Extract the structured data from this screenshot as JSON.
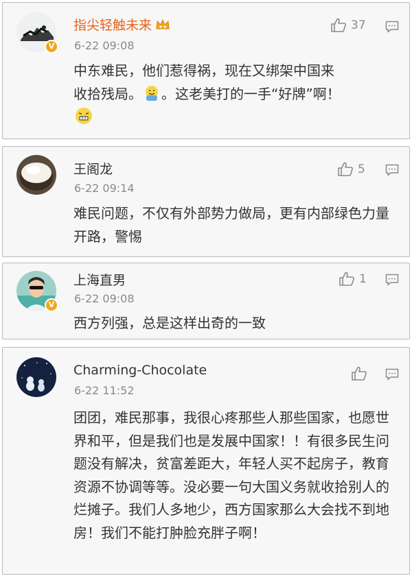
{
  "comments": [
    {
      "username": "指尖轻触未来",
      "time": "6-22 09:08",
      "likes": "37",
      "text_line1": "中东难民，他们惹得祸，现在又绑架中国来",
      "text_line2a": "收拾残局。",
      "text_line2b": "。这老美打的一手“好牌”啊！",
      "verified": true,
      "vip": true
    },
    {
      "username": "王阁龙",
      "time": "6-22 09:14",
      "likes": "5",
      "text": "难民问题，不仅有外部势力做局，更有内部绿色力量开路，警惕"
    },
    {
      "username": "上海直男",
      "time": "6-22 09:08",
      "likes": "1",
      "text": "西方列强，总是这样出奇的一致",
      "verified": true
    },
    {
      "username": "Charming-Chocolate",
      "time": "6-22 11:52",
      "likes": "",
      "text": "团团，难民那事，我很心疼那些人那些国家，也愿世界和平，但是我们也是发展中国家！！有很多民生问题没有解决，贫富差距大，年轻人买不起房子，教育资源不协调等等。没必要一句大国义务就收拾别人的烂摊子。我们人多地少，西方国家那么大会找不到地房！我们不能打肿脸充胖子啊！"
    }
  ],
  "icons": {
    "like": "thumbs-up-icon",
    "reply": "comment-icon",
    "verified": "v-badge-icon",
    "vip": "crown-icon"
  },
  "colors": {
    "vip_name": "#e8641b",
    "badge": "#f3a51a",
    "meta": "#8a8a8a"
  }
}
